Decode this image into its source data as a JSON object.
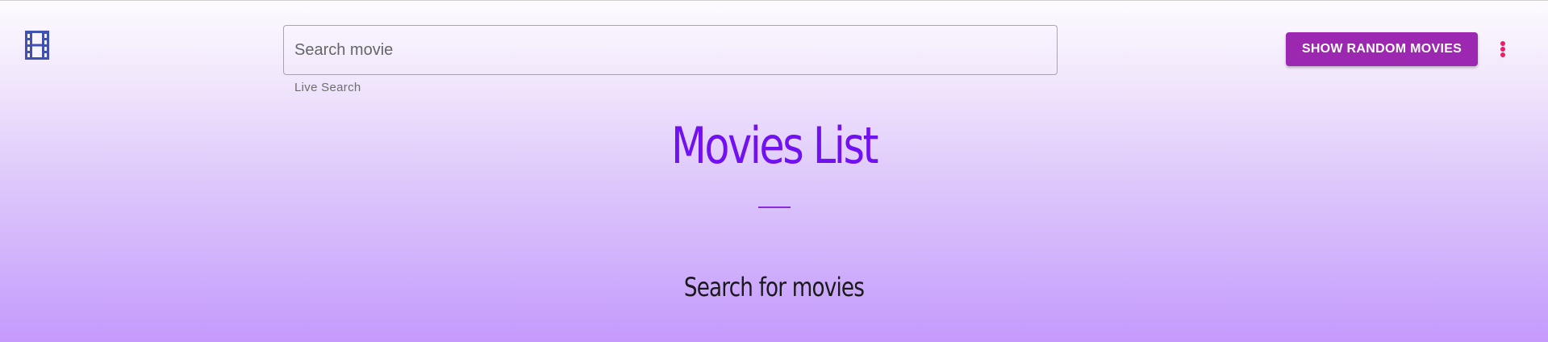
{
  "header": {
    "logo_icon": "film-icon",
    "search": {
      "placeholder": "Search movie",
      "value": "",
      "helper_text": "Live Search"
    },
    "random_button_label": "SHOW RANDOM MOVIES",
    "more_icon": "more-vert-icon"
  },
  "main": {
    "title": "Movies List",
    "subtitle": "Search for movies"
  },
  "colors": {
    "title": "#7110f0",
    "button": "#9c27b0",
    "more_icon": "#e91e63",
    "logo": "#3f51b5"
  }
}
